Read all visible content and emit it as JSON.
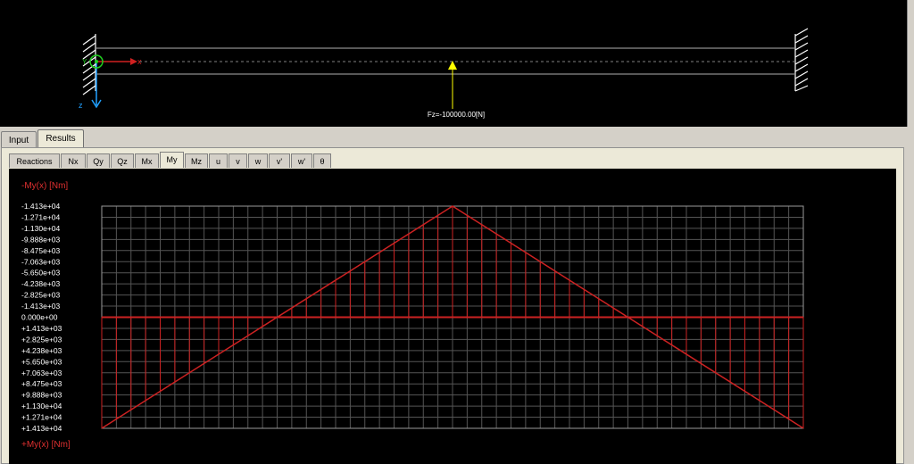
{
  "beam": {
    "load_label": "Fz=-100000.00[N]",
    "axis_x": "x",
    "axis_y": "Y",
    "axis_z": "z",
    "colors": {
      "beam": "#b0b0b0",
      "load": "#ffff00",
      "x_axis": "#d02020",
      "z_axis": "#20a0ff",
      "origin": "#20d020"
    }
  },
  "tabs": {
    "main": [
      "Input",
      "Results"
    ],
    "active_main": "Results",
    "sub": [
      "Reactions",
      "Nx",
      "Qy",
      "Qz",
      "Mx",
      "My",
      "Mz",
      "u",
      "v",
      "w",
      "v'",
      "w'",
      "θ"
    ],
    "active_sub": "My"
  },
  "chart_data": {
    "type": "line",
    "title_top": "-My(x) [Nm]",
    "title_bottom": "+My(x) [Nm]",
    "y_tick_labels": [
      "-1.413e+04",
      "-1.271e+04",
      "-1.130e+04",
      "-9.888e+03",
      "-8.475e+03",
      "-7.063e+03",
      "-5.650e+03",
      "-4.238e+03",
      "-2.825e+03",
      "-1.413e+03",
      "0.000e+00",
      "+1.413e+03",
      "+2.825e+03",
      "+4.238e+03",
      "+5.650e+03",
      "+7.063e+03",
      "+8.475e+03",
      "+9.888e+03",
      "+1.130e+04",
      "+1.271e+04",
      "+1.413e+04"
    ],
    "ylim": [
      -14130,
      14130
    ],
    "y_inverted": true,
    "grid": true,
    "colors": {
      "curve": "#cc2222",
      "grid": "#555555"
    },
    "series": [
      {
        "x": [
          0,
          0.5,
          1
        ],
        "values": [
          14130,
          -14130,
          14130
        ]
      }
    ]
  }
}
